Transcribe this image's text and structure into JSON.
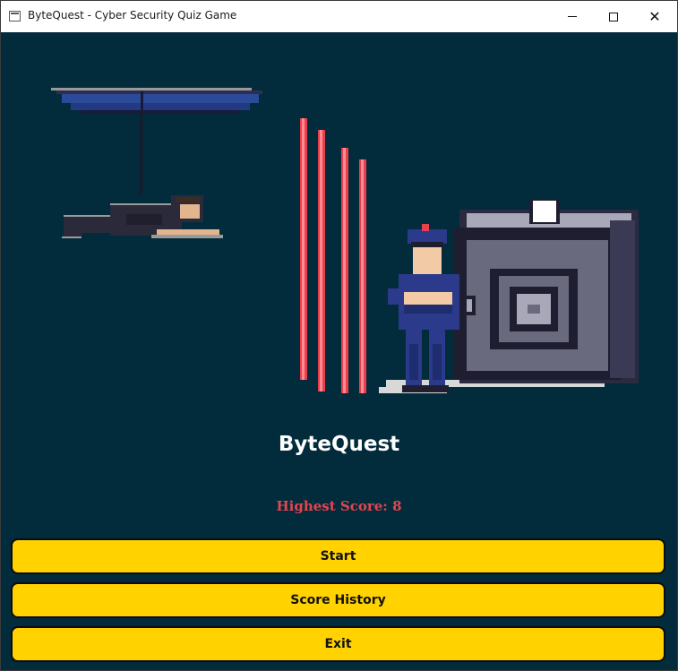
{
  "window": {
    "title": "ByteQuest - Cyber Security Quiz Game",
    "controls": {
      "minimize": "minimize-icon",
      "maximize": "maximize-icon",
      "close": "close-icon"
    }
  },
  "main": {
    "app_title": "ByteQuest",
    "high_score": "Highest Score: 8",
    "buttons": {
      "start": "Start",
      "score_history": "Score History",
      "exit": "Exit"
    }
  },
  "illustration": {
    "elements": [
      "hang-glider-thief",
      "laser-barriers",
      "security-guard",
      "vault-safe"
    ]
  },
  "colors": {
    "background": "#022c3c",
    "button": "#ffd200",
    "high_score": "#e6444e",
    "title": "#ffffff",
    "laser": "#e8414d"
  }
}
